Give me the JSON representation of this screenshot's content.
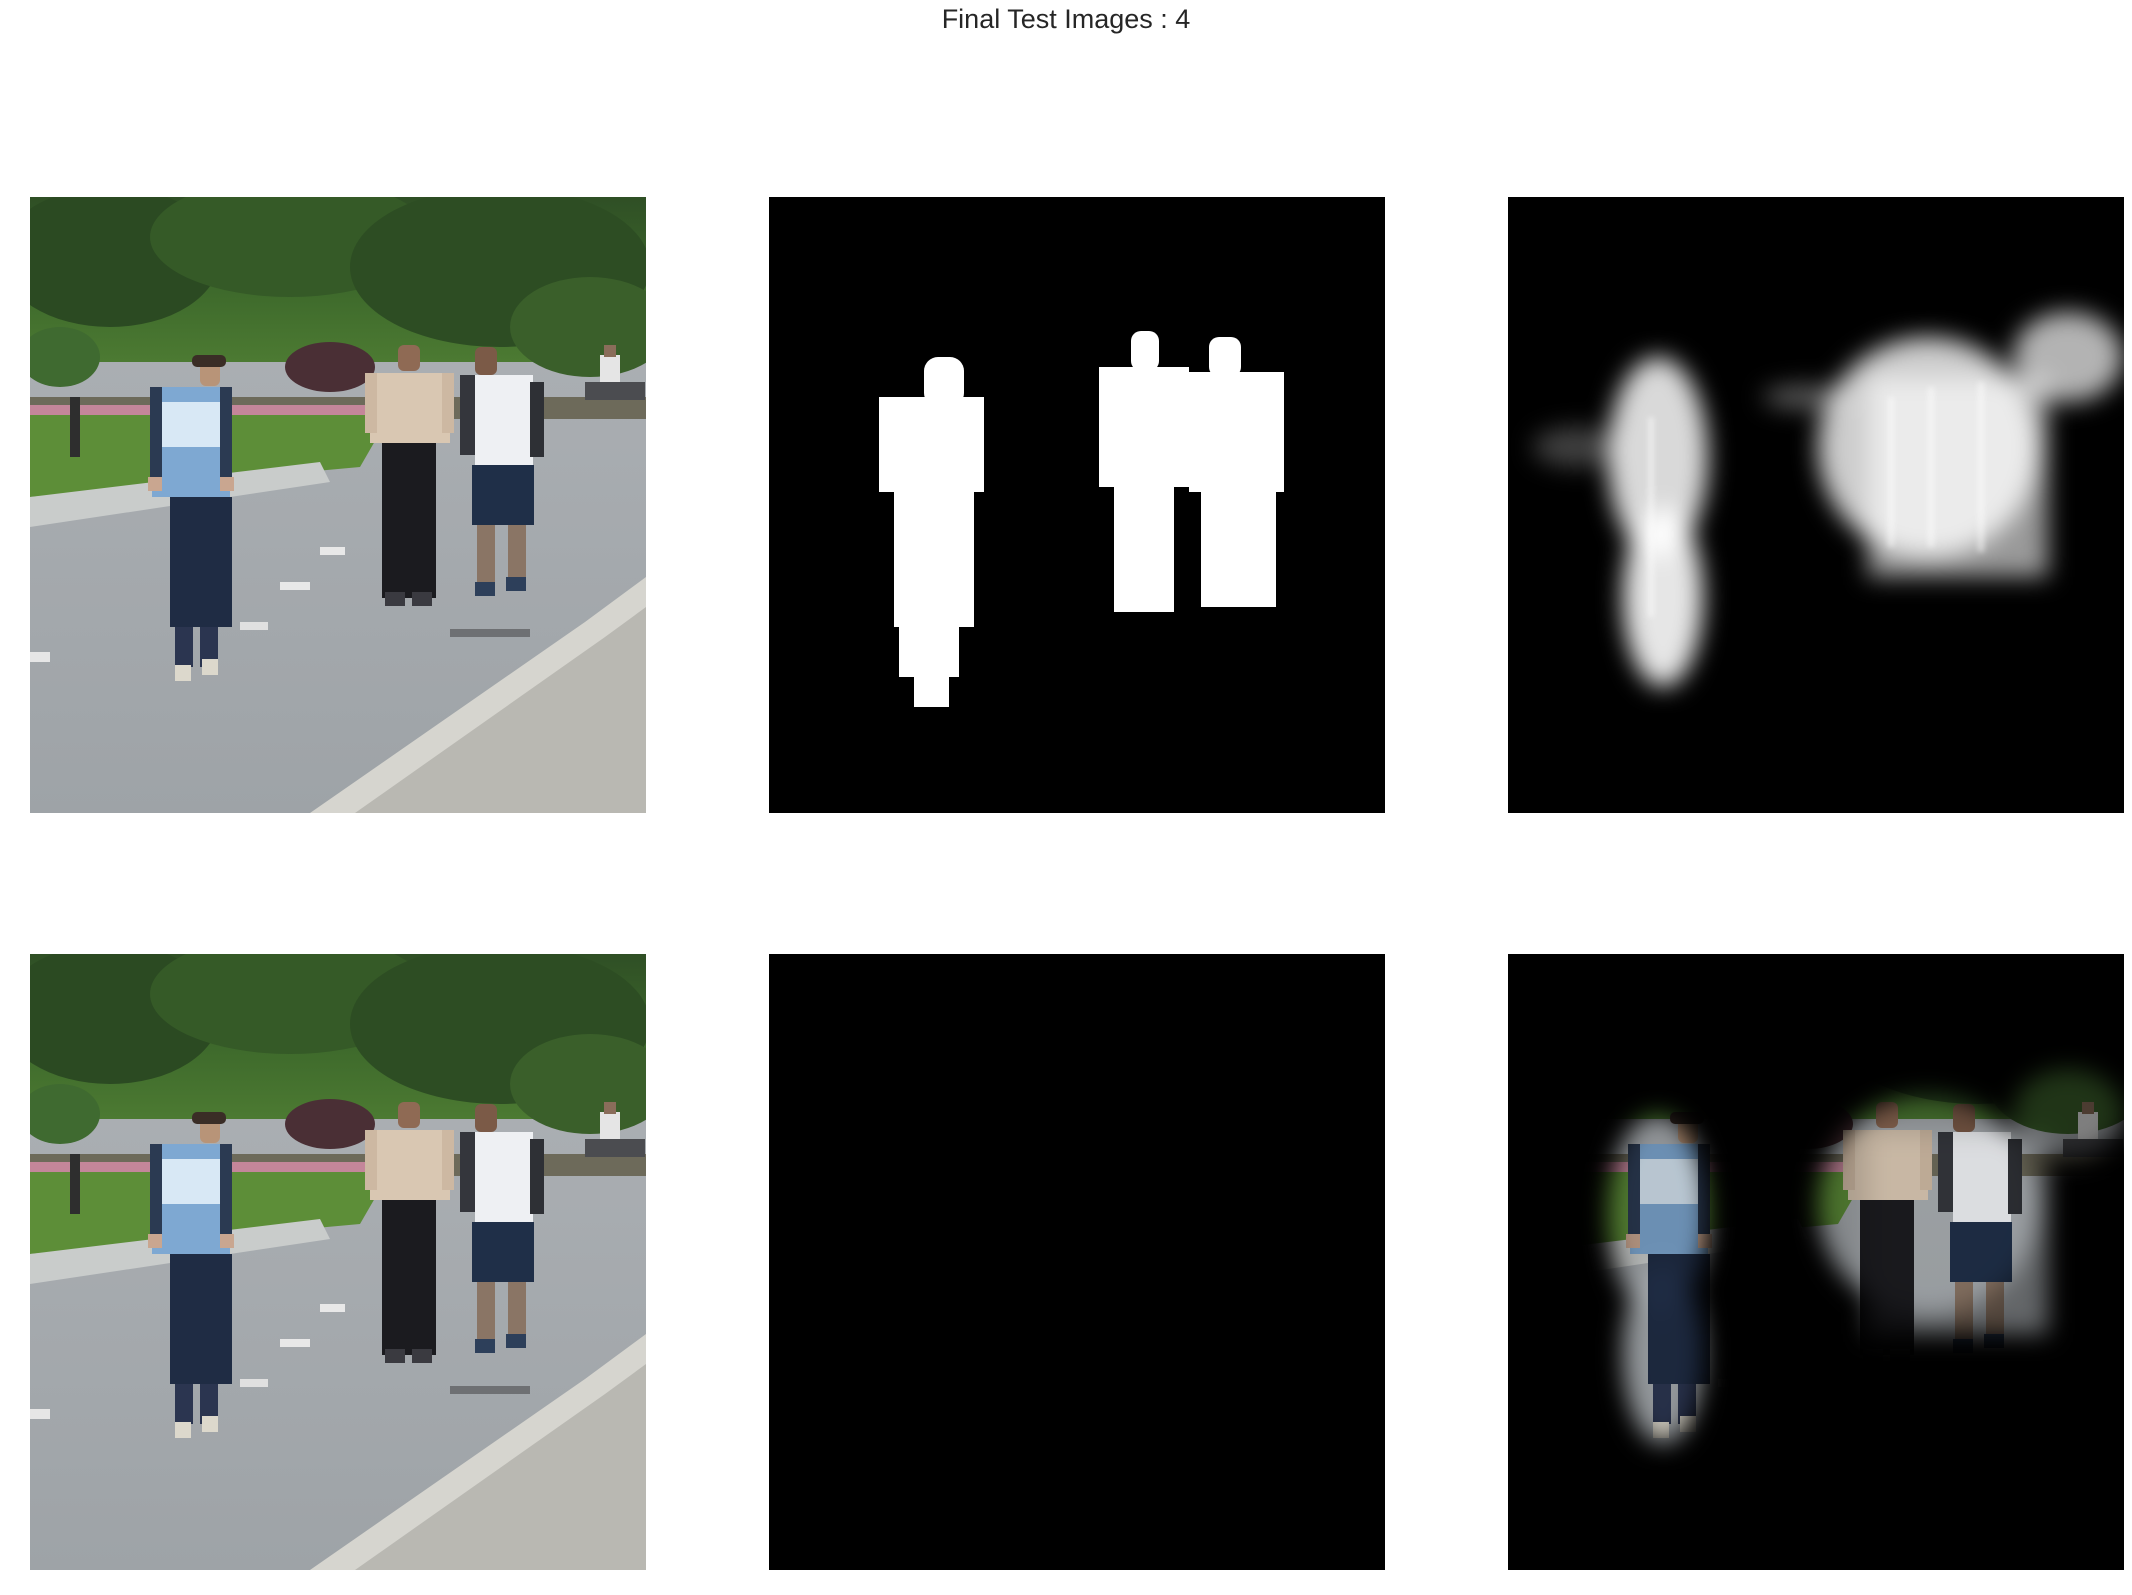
{
  "figure": {
    "suptitle": "Final Test Images : 4"
  },
  "panels": [
    {
      "row": 1,
      "col": 1,
      "content": "input-photo"
    },
    {
      "row": 1,
      "col": 2,
      "content": "ground-truth-mask"
    },
    {
      "row": 1,
      "col": 3,
      "content": "predicted-mask"
    },
    {
      "row": 2,
      "col": 1,
      "content": "input-photo"
    },
    {
      "row": 2,
      "col": 2,
      "content": "masked-ground-truth"
    },
    {
      "row": 2,
      "col": 3,
      "content": "masked-prediction"
    }
  ],
  "colors": {
    "background": "#ffffff",
    "mask_black": "#000000",
    "mask_white": "#ffffff",
    "title_text": "#262626"
  }
}
